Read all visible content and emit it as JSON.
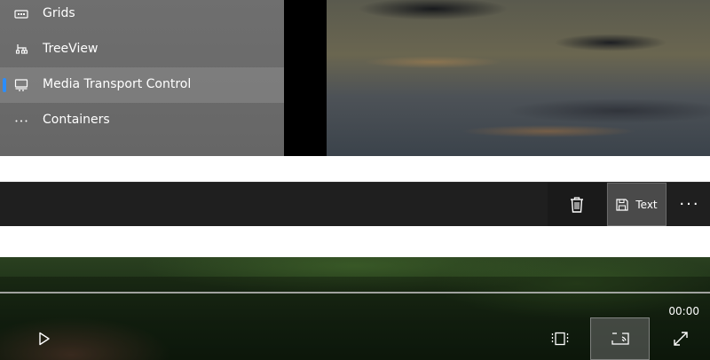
{
  "nav": {
    "items": [
      {
        "label": "Grids",
        "icon": "grid-icon"
      },
      {
        "label": "TreeView",
        "icon": "treeview-icon"
      },
      {
        "label": "Media Transport Control",
        "icon": "media-transport-icon",
        "selected": true
      },
      {
        "label": "Containers",
        "icon": "more-horizontal-icon"
      }
    ],
    "accent": "#2b8dfb"
  },
  "commandbar": {
    "delete_icon": "trash-icon",
    "save_icon": "save-icon",
    "save_label": "Text",
    "more_label": "···"
  },
  "media": {
    "time": "00:00",
    "progress": 0,
    "icons": [
      "play-icon",
      "aspect-ratio-icon",
      "cast-icon",
      "fullscreen-icon"
    ]
  }
}
